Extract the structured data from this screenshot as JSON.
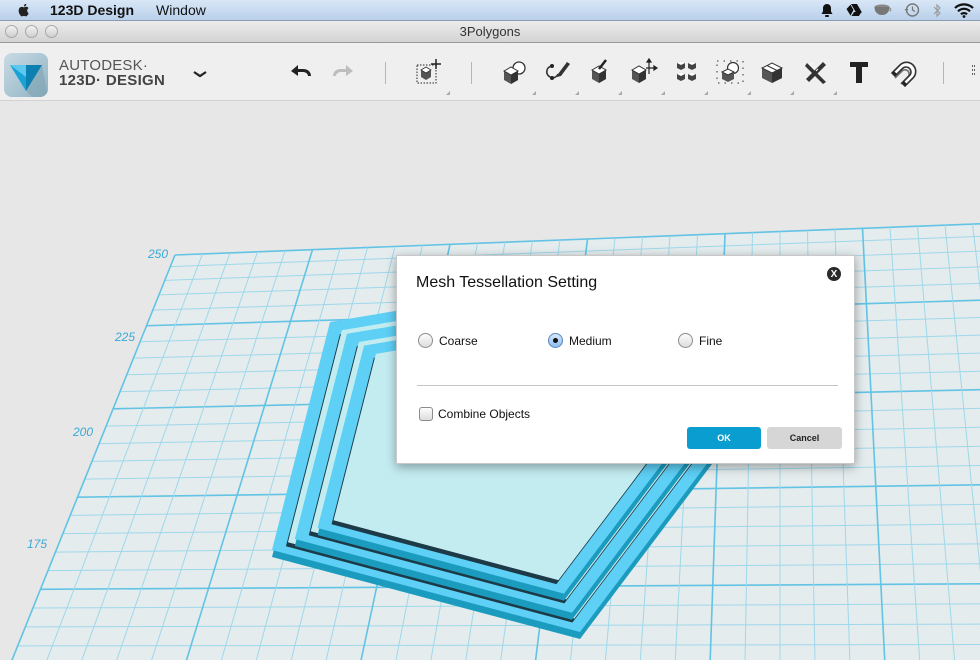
{
  "menubar": {
    "app_name": "123D Design",
    "items": [
      "Window"
    ],
    "status_icons": [
      "notification-bell-icon",
      "google-drive-icon",
      "cup-icon",
      "time-machine-icon",
      "bluetooth-icon",
      "wifi-icon"
    ]
  },
  "window": {
    "title": "3Polygons"
  },
  "toolbar": {
    "brand_line1": "AUTODESK·",
    "brand_line2": "123D· DESIGN",
    "tools": [
      "undo",
      "redo",
      "transform",
      "primitives",
      "sketch",
      "construct",
      "modify",
      "pattern",
      "grouping",
      "combine",
      "measure",
      "text",
      "snap"
    ]
  },
  "viewport": {
    "axis_labels": [
      "250",
      "225",
      "200",
      "175"
    ],
    "colors": {
      "grid_fill": "#e4ecee",
      "grid_line": "#9fd8ea",
      "grid_major": "#62c3e4",
      "shape_top": "#5ecff5",
      "shape_side": "#1b9cbf",
      "shape_dark": "#1d3a48",
      "shape_inner": "#c3ecf1"
    }
  },
  "dialog": {
    "title": "Mesh Tessellation Setting",
    "close_label": "X",
    "options": [
      {
        "label": "Coarse",
        "checked": false
      },
      {
        "label": "Medium",
        "checked": true
      },
      {
        "label": "Fine",
        "checked": false
      }
    ],
    "combine_objects": {
      "label": "Combine Objects",
      "checked": false
    },
    "ok_label": "OK",
    "cancel_label": "Cancel",
    "ok_color": "#0a9dd0"
  }
}
